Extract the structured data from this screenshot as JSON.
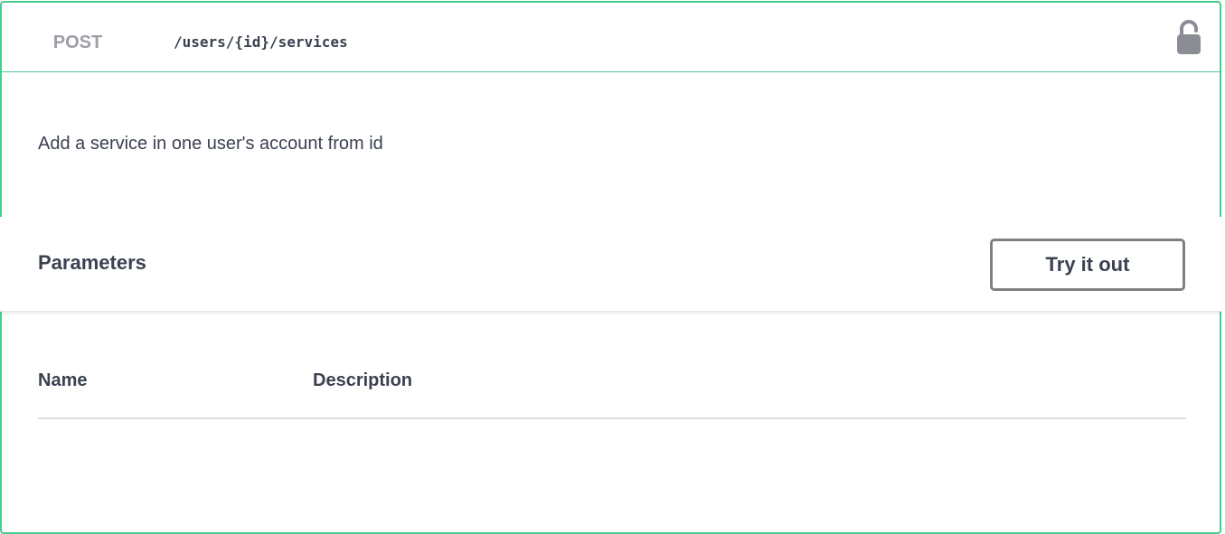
{
  "operation": {
    "method": "POST",
    "path": "/users/{id}/services",
    "lock_icon": "lock-icon",
    "accent_color": "#49cc90"
  },
  "description": "Add a service in one user's account from id",
  "parameters": {
    "title": "Parameters",
    "try_button": "Try it out",
    "columns": [
      "Name",
      "Description"
    ]
  }
}
